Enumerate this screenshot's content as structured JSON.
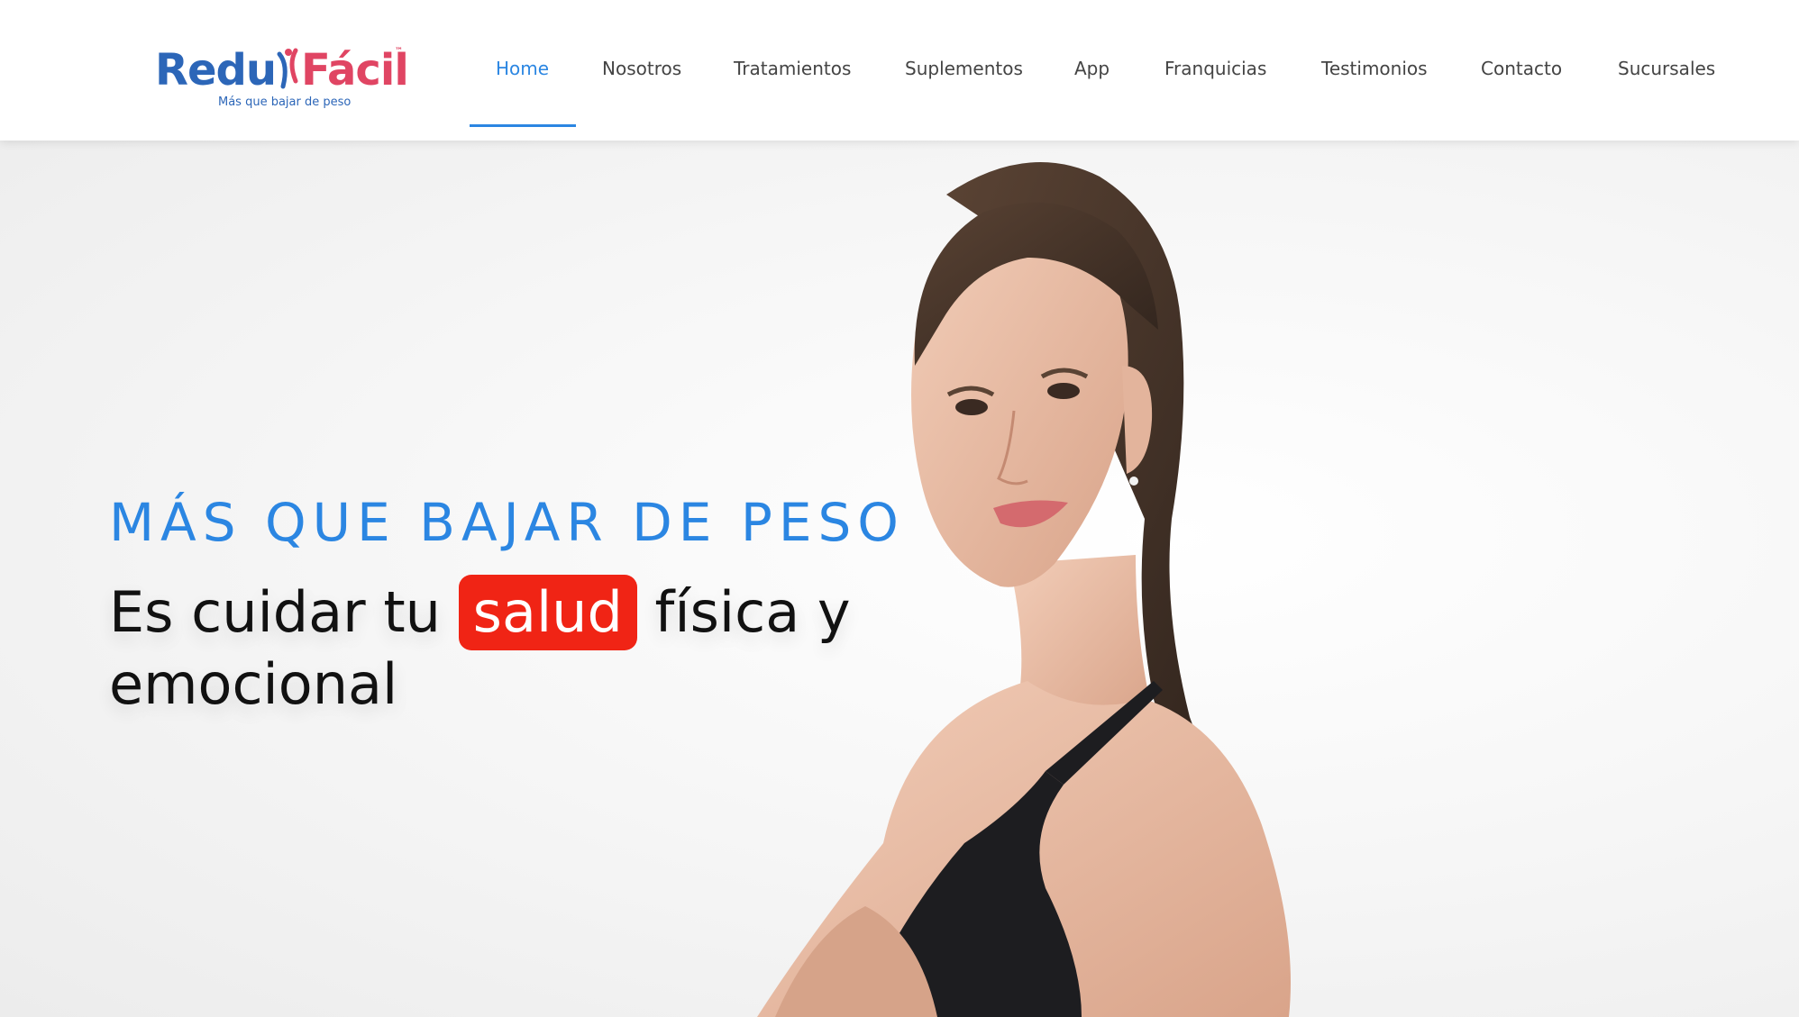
{
  "brand": {
    "name_part1": "Redu",
    "name_part2": "Fácil",
    "trademark": "™",
    "tagline": "Más que bajar de peso",
    "colors": {
      "blue": "#2c66b8",
      "pink": "#e04563"
    }
  },
  "nav": {
    "active_index": 0,
    "items": [
      {
        "label": "Home"
      },
      {
        "label": "Nosotros"
      },
      {
        "label": "Tratamientos"
      },
      {
        "label": "Suplementos"
      },
      {
        "label": "App"
      },
      {
        "label": "Franquicias"
      },
      {
        "label": "Testimonios"
      },
      {
        "label": "Contacto"
      },
      {
        "label": "Sucursales"
      }
    ],
    "active_color": "#2b86e2"
  },
  "hero": {
    "kicker": "MÁS QUE BAJAR DE PESO",
    "line1_before": "Es cuidar tu ",
    "highlight": "salud",
    "line1_after": " física y",
    "line2": "emocional",
    "accent_color": "#2b86e2",
    "highlight_color": "#f02415",
    "image": "woman-portrait"
  }
}
